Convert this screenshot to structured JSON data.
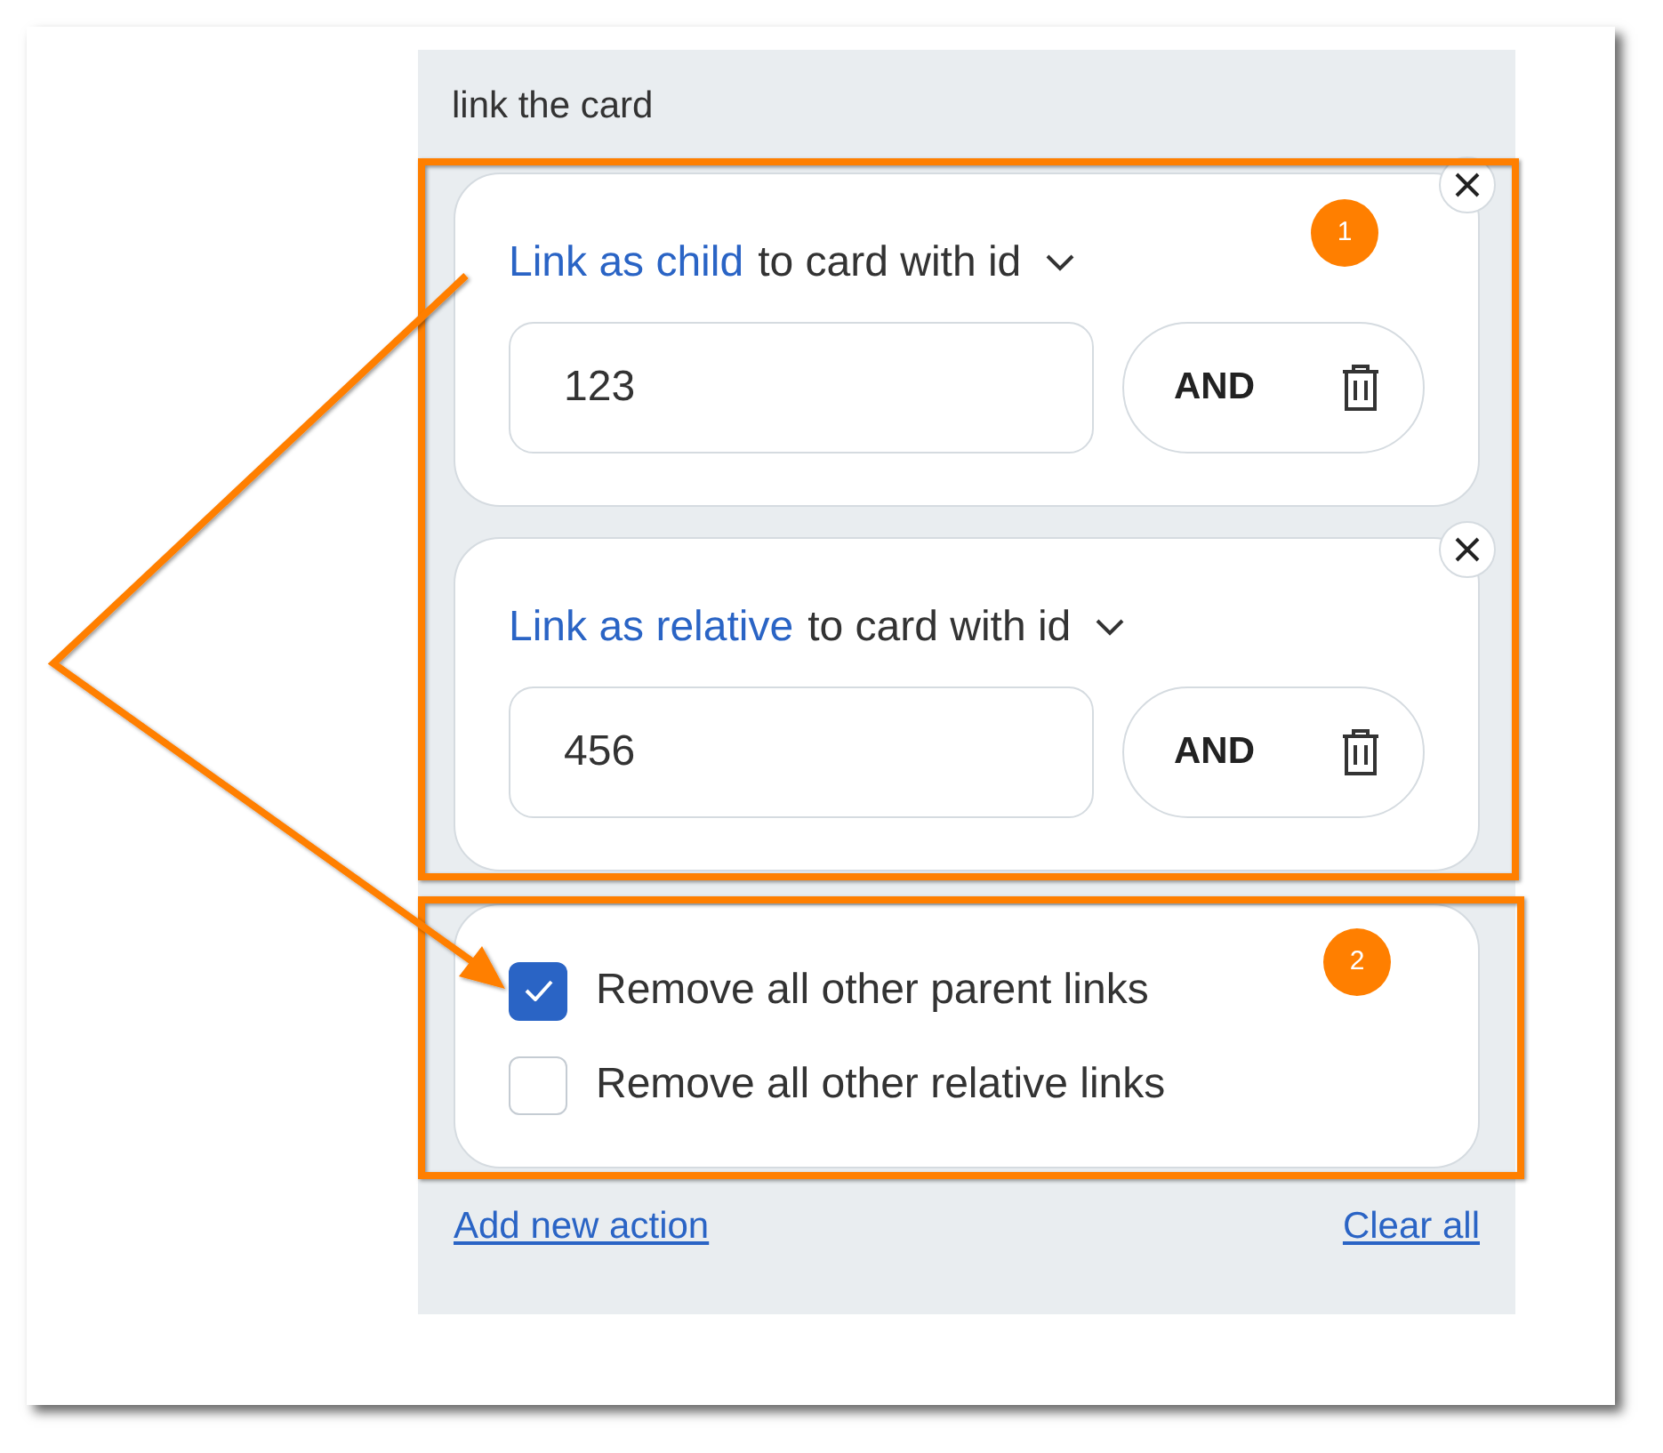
{
  "panel": {
    "title": "link the card"
  },
  "actions": [
    {
      "link_type": "Link as child",
      "rest": "to card with id",
      "value": "123",
      "operator": "AND"
    },
    {
      "link_type": "Link as relative",
      "rest": "to card with id",
      "value": "456",
      "operator": "AND"
    }
  ],
  "options": [
    {
      "label": "Remove all other parent links",
      "checked": true
    },
    {
      "label": "Remove all other relative links",
      "checked": false
    }
  ],
  "footer": {
    "add_link": "Add new action",
    "clear_link": "Clear all"
  },
  "annotations": [
    {
      "label": "1"
    },
    {
      "label": "2"
    }
  ]
}
